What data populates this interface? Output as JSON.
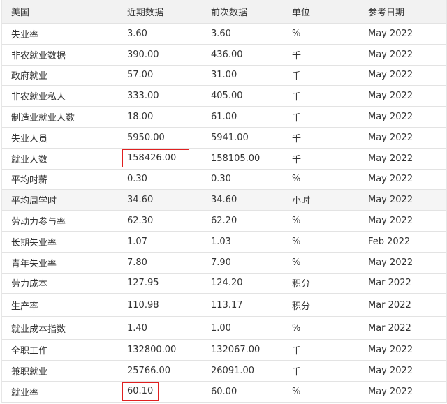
{
  "header": {
    "col1": "美国",
    "col2": "近期数据",
    "col3": "前次数据",
    "col4": "单位",
    "col5": "参考日期"
  },
  "rows": [
    {
      "name": "失业率",
      "recent": "3.60",
      "previous": "3.60",
      "unit": "%",
      "date": "May 2022"
    },
    {
      "name": "非农就业数据",
      "recent": "390.00",
      "previous": "436.00",
      "unit": "千",
      "date": "May 2022"
    },
    {
      "name": "政府就业",
      "recent": "57.00",
      "previous": "31.00",
      "unit": "千",
      "date": "May 2022"
    },
    {
      "name": "非农就业私人",
      "recent": "333.00",
      "previous": "405.00",
      "unit": "千",
      "date": "May 2022"
    },
    {
      "name": "制造业就业人数",
      "recent": "18.00",
      "previous": "61.00",
      "unit": "千",
      "date": "May 2022"
    },
    {
      "name": "失业人员",
      "recent": "5950.00",
      "previous": "5941.00",
      "unit": "千",
      "date": "May 2022"
    },
    {
      "name": "就业人数",
      "recent": "158426.00",
      "previous": "158105.00",
      "unit": "千",
      "date": "May 2022"
    },
    {
      "name": "平均时薪",
      "recent": "0.30",
      "previous": "0.30",
      "unit": "%",
      "date": "May 2022"
    },
    {
      "name": "平均周学时",
      "recent": "34.60",
      "previous": "34.60",
      "unit": "小时",
      "date": "May 2022"
    },
    {
      "name": "劳动力参与率",
      "recent": "62.30",
      "previous": "62.20",
      "unit": "%",
      "date": "May 2022"
    },
    {
      "name": "长期失业率",
      "recent": "1.07",
      "previous": "1.03",
      "unit": "%",
      "date": "Feb 2022"
    },
    {
      "name": "青年失业率",
      "recent": "7.80",
      "previous": "7.90",
      "unit": "%",
      "date": "May 2022"
    },
    {
      "name": "劳力成本",
      "recent": "127.95",
      "previous": "124.20",
      "unit": "积分",
      "date": "Mar 2022"
    },
    {
      "name": "生产率",
      "recent": "110.98",
      "previous": "113.17",
      "unit": "积分",
      "date": "Mar 2022"
    },
    {
      "name": "就业成本指数",
      "recent": "1.40",
      "previous": "1.00",
      "unit": "%",
      "date": "Mar 2022"
    },
    {
      "name": "全职工作",
      "recent": "132800.00",
      "previous": "132067.00",
      "unit": "千",
      "date": "May 2022"
    },
    {
      "name": "兼职就业",
      "recent": "25766.00",
      "previous": "26091.00",
      "unit": "千",
      "date": "May 2022"
    },
    {
      "name": "就业率",
      "recent": "60.10",
      "previous": "60.00",
      "unit": "%",
      "date": "May 2022"
    }
  ],
  "colors": {
    "highlight_border": "#e02020",
    "header_bg": "#f2f2f2",
    "row_alt_bg": "#f5f5f5"
  }
}
